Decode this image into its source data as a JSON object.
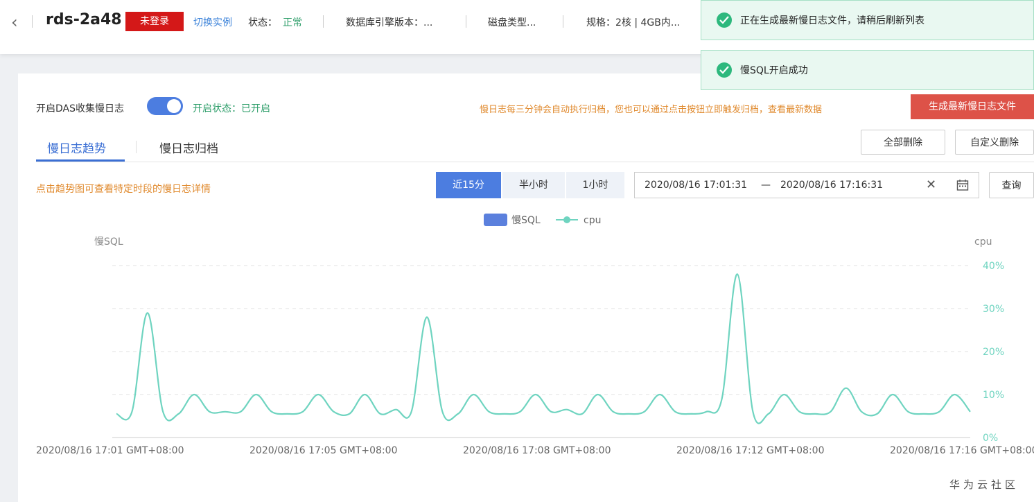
{
  "header": {
    "instance_name": "rds-2a48",
    "login_badge": "未登录",
    "switch_instance": "切换实例",
    "status_label": "状态：",
    "status_value": "正常",
    "engine_label": "数据库引擎版本：...",
    "disk_label": "磁盘类型...",
    "spec_label": "规格：",
    "spec_value": "2核 | 4GB内..."
  },
  "toasts": [
    {
      "message": "正在生成最新慢日志文件，请稍后刷新列表"
    },
    {
      "message": "慢SQL开启成功"
    }
  ],
  "das": {
    "toggle_label": "开启DAS收集慢日志",
    "toggle_on": true,
    "status_text": "开启状态：已开启",
    "archive_hint": "慢日志每三分钟会自动执行归档，您也可以通过点击按钮立即触发归档，查看最新数据",
    "generate_button": "生成最新慢日志文件"
  },
  "tabs": [
    {
      "label": "慢日志趋势",
      "active": true
    },
    {
      "label": "慢日志归档",
      "active": false
    }
  ],
  "actions": {
    "delete_all": "全部删除",
    "custom_delete": "自定义删除",
    "query": "查询"
  },
  "trend_hint": "点击趋势图可查看特定时段的慢日志详情",
  "time_ranges": [
    {
      "label": "近15分",
      "active": true
    },
    {
      "label": "半小时",
      "active": false
    },
    {
      "label": "1小时",
      "active": false
    }
  ],
  "date_range": {
    "start": "2020/08/16 17:01:31",
    "separator": "—",
    "end": "2020/08/16 17:16:31"
  },
  "colors": {
    "accent": "#4c7de0",
    "cpu_line": "#6fd4c0",
    "danger": "#dd5248",
    "warning_text": "#e08a2e",
    "success": "#2e9e6a"
  },
  "watermark": "华为云社区",
  "chart_data": {
    "type": "line",
    "legend": [
      "慢SQL",
      "cpu"
    ],
    "y_left_label": "慢SQL",
    "y_right_label": "cpu",
    "y_right_ticks": [
      "40%",
      "30%",
      "20%",
      "10%",
      "0%"
    ],
    "ylim": [
      0,
      40
    ],
    "x_tick_labels": [
      "2020/08/16 17:01 GMT+08:00",
      "2020/08/16 17:05 GMT+08:00",
      "2020/08/16 17:08 GMT+08:00",
      "2020/08/16 17:12 GMT+08:00",
      "2020/08/16 17:16 GMT+08:00"
    ],
    "series": [
      {
        "name": "cpu",
        "values": [
          5.5,
          6,
          29,
          6,
          5.5,
          10,
          6,
          6,
          6,
          10,
          6,
          5.5,
          6,
          10,
          6,
          5.5,
          10,
          5.5,
          6.5,
          6,
          28,
          6,
          5.5,
          10,
          6,
          5.5,
          6,
          10,
          6,
          6.5,
          5.5,
          10,
          6,
          5.5,
          6,
          10,
          6,
          5.5,
          6,
          9,
          38,
          6,
          5.5,
          10,
          6,
          5.5,
          6,
          11.5,
          6,
          5.5,
          10,
          6,
          5.5,
          6,
          10,
          6
        ]
      }
    ]
  }
}
